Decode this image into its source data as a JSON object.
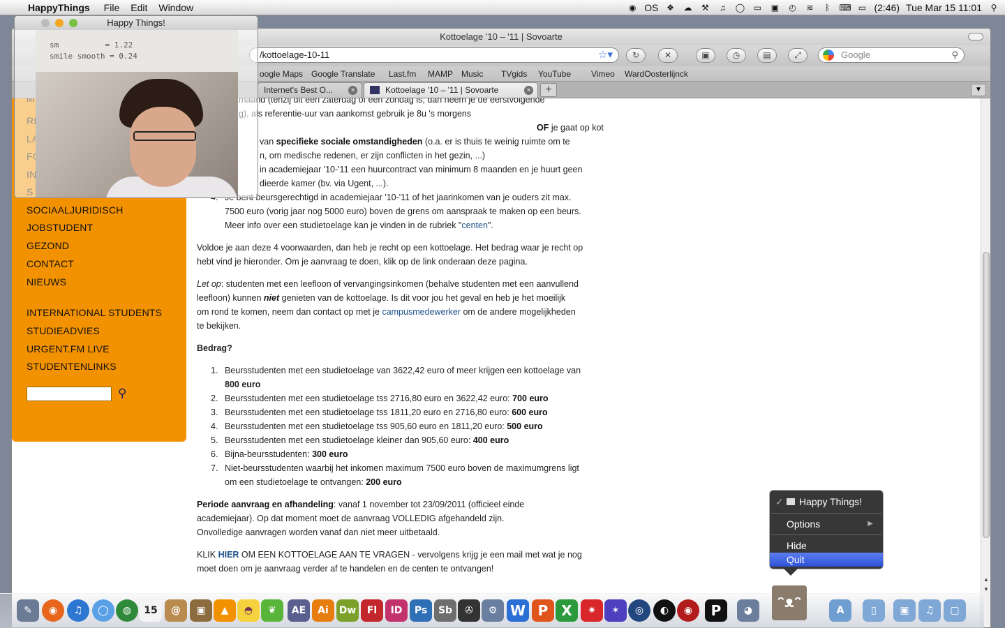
{
  "menubar": {
    "app_name": "HappyThings",
    "items": [
      "File",
      "Edit",
      "Window"
    ],
    "status": {
      "os_icon": "OS",
      "battery": "(2:46)",
      "datetime": "Tue Mar 15  11:01"
    }
  },
  "webcam_window": {
    "title": "Happy Things!",
    "overlay": "sm          = 1.22\nsmile smooth = 0.24"
  },
  "browser": {
    "title": "Kottoelage '10 – '11 | Sovoarte",
    "url": "/kottoelage-10-11",
    "search_placeholder": "Google",
    "bookmarks": [
      "oogle Maps",
      "Google Translate",
      "Last.fm",
      "MAMP",
      "Music",
      "TVgids",
      "YouTube",
      "Vimeo",
      "WardOosterlijnck"
    ],
    "tabs": [
      {
        "label": "Internet's Best O..."
      },
      {
        "label": "Kottoelage '10 – '11 | Sovoarte"
      }
    ]
  },
  "sidebar": {
    "items": [
      "SOCIAALJURIDISCH",
      "JOBSTUDENT",
      "GEZOND",
      "CONTACT",
      "NIEUWS",
      "INTERNATIONAL STUDENTS",
      "STUDIEADVIES",
      "URGENT.FM LIVE",
      "STUDENTENLINKS"
    ],
    "partial_items": [
      "M",
      "RI",
      "LA",
      "FC",
      "IN",
      "S"
    ]
  },
  "article": {
    "top1": "maand (tenzij dit een zaterdag of een zondag is, dan neem je de eerstvolgende",
    "top2": "g), als referentie-uur van aankomst gebruik je 8u 's morgens",
    "of": "OF",
    "of_rest": " je gaat op kot",
    "soc_pre": "van ",
    "soc_bold": "specifieke sociale omstandigheden",
    "soc_post": " (o.a. er is thuis te weinig ruimte om te",
    "soc2": "n, om medische redenen, er zijn conflicten in het gezin, ...)",
    "huur1": "in academiejaar '10-'11 een huurcontract van minimum 8 maanden en je huurt geen",
    "huur2": "dieerde kamer (bv. via Ugent, ...).",
    "item4_num": "4.",
    "item4_1": "Je bent beursgerechtigd in academiejaar '10-'11 of het jaarinkomen van je ouders zit max.",
    "item4_2": "7500 euro (vorig jaar nog 5000 euro) boven de grens om aanspraak te maken op een beurs.",
    "item4_3_pre": "Meer info over een studietoelage kan je vinden in de rubriek \"",
    "item4_3_link": "centen",
    "item4_3_post": "\".",
    "voldoe1": "Voldoe je aan deze 4 voorwaarden, dan heb je recht op een kottoelage. Het bedrag waar je recht op",
    "voldoe2": "hebt vind je hieronder. Om je aanvraag te doen, klik op de link onderaan deze pagina.",
    "letop_italic": "Let op",
    "letop1": ": studenten met een leefloon of vervangingsinkomen (behalve studenten met een aanvullend",
    "letop2_pre": "leefloon) kunnen ",
    "letop2_bold": "niet",
    "letop2_post": " genieten van de kottoelage. Is dit voor jou het geval en heb je het moeilijk",
    "letop3_pre": "om rond te komen, neem dan contact op met je ",
    "letop3_link": "campusmedewerker",
    "letop3_post": " om de andere mogelijkheden",
    "letop4": "te bekijken.",
    "bedrag_heading": "Bedrag?",
    "list": [
      {
        "num": "1.",
        "text": "Beursstudenten met een studietoelage van 3622,42 euro of meer krijgen een kottoelage van",
        "text2": "",
        "amount": "800 euro"
      },
      {
        "num": "2.",
        "text": "Beursstudenten met een studietoelage tss 2716,80 euro en 3622,42 euro: ",
        "amount": "700 euro"
      },
      {
        "num": "3.",
        "text": "Beursstudenten met een studietoelage tss 1811,20 euro en 2716,80 euro: ",
        "amount": "600 euro"
      },
      {
        "num": "4.",
        "text": "Beursstudenten met een studietoelage tss 905,60 euro en 1811,20 euro: ",
        "amount": "500 euro"
      },
      {
        "num": "5.",
        "text": "Beursstudenten met een studietoelage kleiner dan 905,60 euro: ",
        "amount": "400 euro"
      },
      {
        "num": "6.",
        "text": "Bijna-beursstudenten: ",
        "amount": "300 euro"
      },
      {
        "num": "7.",
        "text": "Niet-beursstudenten waarbij het inkomen maximum 7500 euro boven de maximumgrens ligt",
        "text2": "om een studietoelage te ontvangen: ",
        "amount": "200 euro"
      }
    ],
    "periode_bold": "Periode aanvraag en afhandeling",
    "periode1": ": vanaf 1 november tot 23/09/2011 (officieel einde",
    "periode2": "academiejaar). Op dat moment moet de aanvraag VOLLEDIG afgehandeld zijn.",
    "periode3": "Onvolledige aanvragen worden vanaf dan niet meer uitbetaald.",
    "klik_pre": "KLIK ",
    "klik_link": "HIER",
    "klik_post": " OM EEN KOTTOELAGE AAN TE VRAGEN - vervolgens krijg je een mail met wat je nog",
    "klik2": "moet doen om je aanvraag verder af te handelen en de centen te ontvangen!"
  },
  "context_menu": {
    "title": "Happy Things!",
    "options": "Options",
    "hide": "Hide",
    "quit": "Quit"
  },
  "dock": {
    "labels": [
      "AE",
      "Ai",
      "Dw",
      "Fl",
      "ID",
      "Ps",
      "Sb",
      "W",
      "P",
      "X",
      "15"
    ]
  },
  "colors": {
    "sidebar_orange": "#f39200",
    "link_blue": "#1b4f8a",
    "menu_highlight": "#3a5ee0"
  }
}
